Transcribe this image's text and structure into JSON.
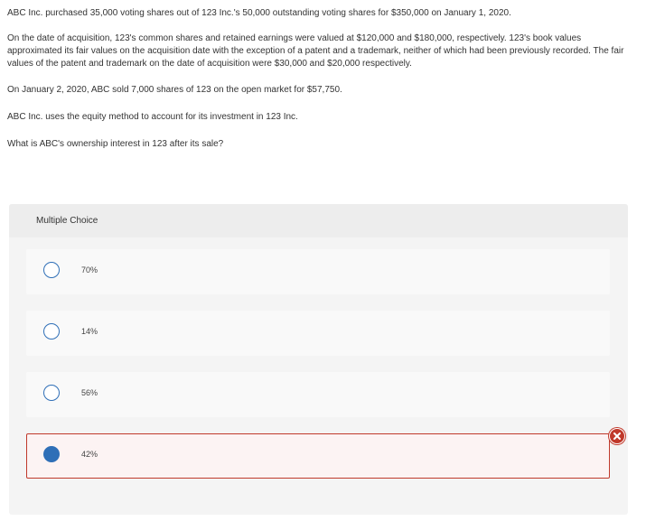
{
  "question": {
    "paragraphs": [
      "ABC Inc. purchased 35,000 voting shares out of 123 Inc.'s 50,000 outstanding voting shares for $350,000 on January 1, 2020.",
      "On the date of acquisition, 123's common shares and retained earnings were valued at $120,000 and $180,000, respectively. 123's book values approximated its fair values on the acquisition date with the exception of a patent and a trademark, neither of which had been previously recorded. The fair values of the patent and trademark on the date of acquisition were $30,000 and $20,000 respectively.",
      "On January 2, 2020, ABC sold 7,000 shares of 123 on the open market for $57,750.",
      "ABC Inc. uses the equity method to account for its investment in 123 Inc.",
      "What is ABC's ownership interest in 123 after its sale?"
    ]
  },
  "multiple_choice": {
    "header": "Multiple Choice",
    "options": [
      {
        "label": "70%",
        "selected": false
      },
      {
        "label": "14%",
        "selected": false
      },
      {
        "label": "56%",
        "selected": false
      },
      {
        "label": "42%",
        "selected": true
      }
    ],
    "result_icon": "incorrect-x-icon"
  },
  "colors": {
    "radio": "#2f6fb7",
    "incorrect": "#c0392b",
    "panel_bg": "#f4f4f4"
  }
}
